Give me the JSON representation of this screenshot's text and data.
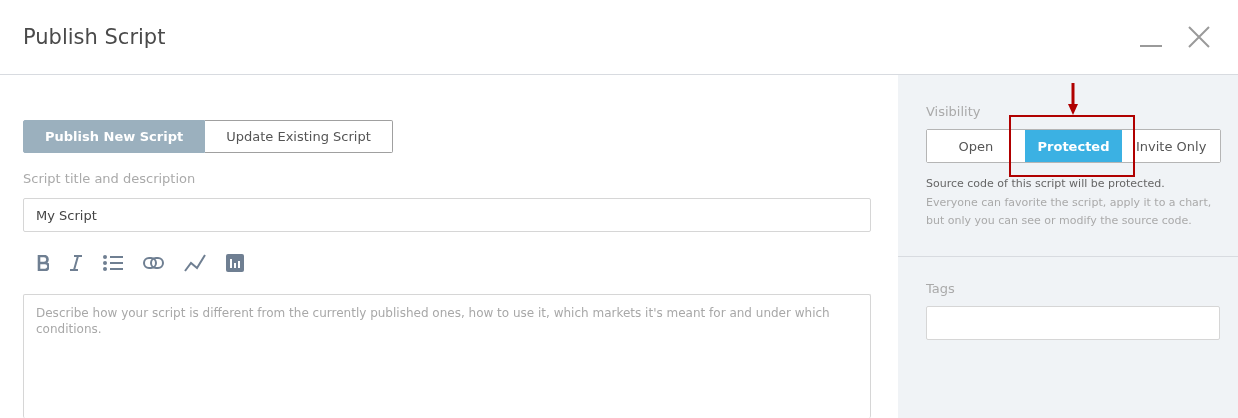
{
  "window": {
    "title": "Publish Script"
  },
  "mode_tabs": [
    {
      "label": "Publish New Script",
      "selected": true
    },
    {
      "label": "Update Existing Script",
      "selected": false
    }
  ],
  "title_section": {
    "label": "Script title and description",
    "title_value": "My Script"
  },
  "format_toolbar": [
    {
      "kind": "bold"
    },
    {
      "kind": "italic"
    },
    {
      "kind": "list"
    },
    {
      "kind": "link"
    },
    {
      "kind": "line"
    },
    {
      "kind": "chart"
    }
  ],
  "description": {
    "placeholder": "Describe how your script is different from the currently published ones, how to use it, which markets it's meant for and under which conditions."
  },
  "visibility": {
    "label": "Visibility",
    "options": [
      {
        "label": "Open",
        "selected": false
      },
      {
        "label": "Protected",
        "selected": true
      },
      {
        "label": "Invite Only",
        "selected": false
      }
    ],
    "note": "Source code of this script will be protected.",
    "hint": "Everyone can favorite the script, apply it to a chart, but only you can see or modify the source code."
  },
  "tags": {
    "label": "Tags"
  },
  "annotation": {
    "kind": "highlight"
  }
}
